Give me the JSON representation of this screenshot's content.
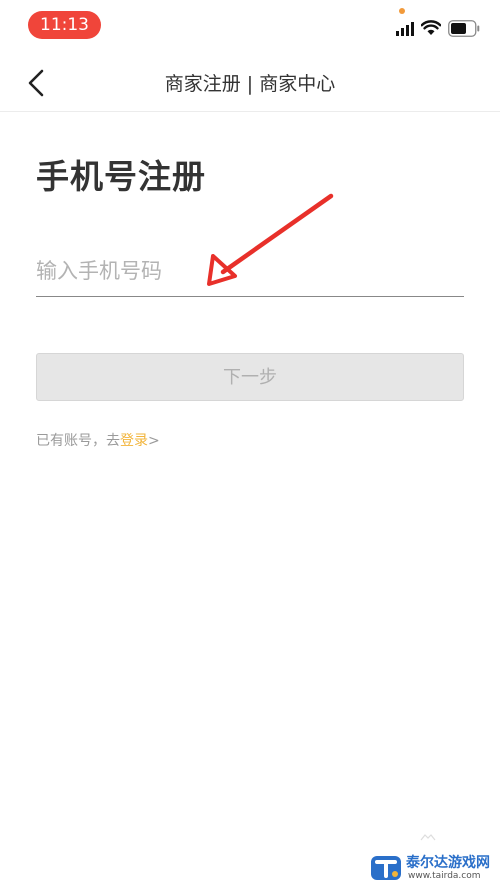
{
  "status_bar": {
    "time": "11:13",
    "icons": [
      "signal-icon",
      "wifi-icon",
      "battery-icon"
    ],
    "time_pill_color": "#f0453a"
  },
  "nav": {
    "title": "商家注册 | 商家中心",
    "back_icon": "chevron-left-icon"
  },
  "page": {
    "title": "手机号注册"
  },
  "form": {
    "phone_placeholder": "输入手机号码",
    "phone_value": "",
    "next_button_label": "下一步",
    "next_button_enabled": false
  },
  "login_hint": {
    "prefix": "已有账号，去",
    "link": "登录",
    "suffix": ">"
  },
  "annotation": {
    "type": "red-arrow",
    "color": "#e8302a"
  },
  "watermark": {
    "name": "泰尔达游戏网",
    "url": "www.tairda.com"
  },
  "colors": {
    "accent_link": "#f2b43a",
    "disabled_button_bg": "#e6e6e6",
    "title_text": "#333333"
  }
}
